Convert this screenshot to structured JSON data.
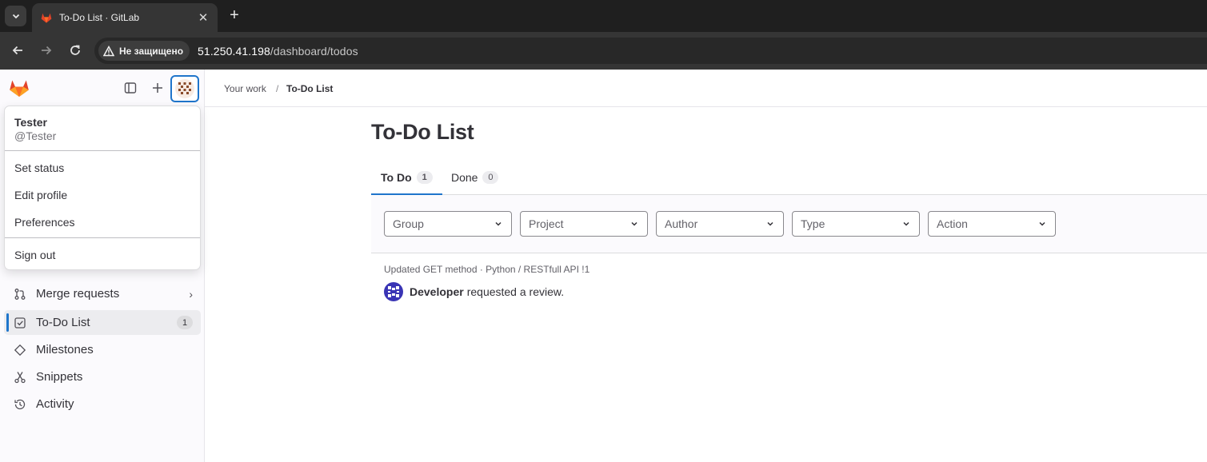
{
  "browser": {
    "tab_title": "To-Do List · GitLab",
    "close_glyph": "✕",
    "new_tab_glyph": "+",
    "security_label": "Не защищено",
    "url_host": "51.250.41.198",
    "url_path": "/dashboard/todos"
  },
  "sidebar": {
    "nav_items": [
      {
        "label": "Merge requests",
        "chevron": "›"
      },
      {
        "label": "To-Do List",
        "count": "1"
      },
      {
        "label": "Milestones"
      },
      {
        "label": "Snippets"
      },
      {
        "label": "Activity"
      }
    ]
  },
  "user_menu": {
    "name": "Tester",
    "handle": "@Tester",
    "items": [
      "Set status",
      "Edit profile",
      "Preferences"
    ],
    "sign_out": "Sign out"
  },
  "breadcrumb": {
    "parent": "Your work",
    "separator": "/",
    "current": "To-Do List"
  },
  "page": {
    "title": "To-Do List"
  },
  "tabs": [
    {
      "label": "To Do",
      "count": "1"
    },
    {
      "label": "Done",
      "count": "0"
    }
  ],
  "filters": [
    {
      "label": "Group"
    },
    {
      "label": "Project"
    },
    {
      "label": "Author"
    },
    {
      "label": "Type"
    },
    {
      "label": "Action"
    }
  ],
  "todos": [
    {
      "context": "Updated GET method · Python / RESTfull API !1",
      "author": "Developer",
      "action": "requested a review."
    }
  ],
  "colors": {
    "accent": "#1f75cb",
    "gitlab_orange": "#fc6d26",
    "developer_avatar": "#3a35b5"
  }
}
